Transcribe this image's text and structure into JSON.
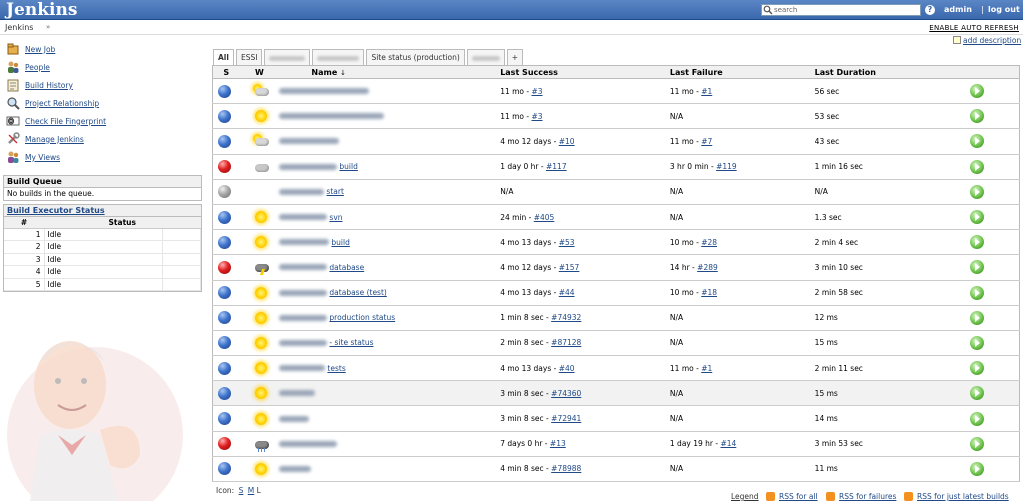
{
  "header": {
    "title": "Jenkins",
    "search_placeholder": "search",
    "help_label": "?",
    "user": "admin",
    "separator": "|",
    "logout": "log out"
  },
  "breadcrumb": {
    "root": "Jenkins",
    "arrow": "»",
    "auto_refresh": "ENABLE AUTO REFRESH"
  },
  "side_tasks": [
    {
      "label": "New Job",
      "icon": "new-job-icon"
    },
    {
      "label": "People",
      "icon": "people-icon"
    },
    {
      "label": "Build History",
      "icon": "build-history-icon"
    },
    {
      "label": "Project Relationship",
      "icon": "magnifier-icon"
    },
    {
      "label": "Check File Fingerprint",
      "icon": "fingerprint-icon"
    },
    {
      "label": "Manage Jenkins",
      "icon": "wrench-icon"
    },
    {
      "label": "My Views",
      "icon": "views-icon"
    }
  ],
  "build_queue": {
    "title": "Build Queue",
    "empty_text": "No builds in the queue."
  },
  "executors": {
    "title": "Build Executor Status",
    "col_num": "#",
    "col_status": "Status",
    "rows": [
      {
        "n": "1",
        "status": "Idle"
      },
      {
        "n": "2",
        "status": "Idle"
      },
      {
        "n": "3",
        "status": "Idle"
      },
      {
        "n": "4",
        "status": "Idle"
      },
      {
        "n": "5",
        "status": "Idle"
      }
    ]
  },
  "add_description": "add description",
  "tabs": [
    {
      "label": "All",
      "active": true
    },
    {
      "label": "ESSI"
    },
    {
      "label": ""
    },
    {
      "label": ""
    },
    {
      "label": "Site status (production)"
    },
    {
      "label": ""
    },
    {
      "label": "+"
    }
  ],
  "table": {
    "headers": {
      "s": "S",
      "w": "W",
      "name": "Name",
      "sort_arrow": "↓",
      "last_success": "Last Success",
      "last_failure": "Last Failure",
      "last_duration": "Last Duration"
    },
    "rows": [
      {
        "status": "blue",
        "weather": "cloud-sun",
        "name": "",
        "last_success": "11 mo - ",
        "success_link": "#3",
        "last_failure": "11 mo - ",
        "failure_link": "#1",
        "duration": "56 sec"
      },
      {
        "status": "blue",
        "weather": "sun",
        "name": "",
        "last_success": "11 mo - ",
        "success_link": "#3",
        "last_failure": "N/A",
        "failure_link": "",
        "duration": "53 sec"
      },
      {
        "status": "blue",
        "weather": "cloud-sun",
        "name": "",
        "last_success": "4 mo 12 days - ",
        "success_link": "#10",
        "last_failure": "11 mo - ",
        "failure_link": "#7",
        "duration": "43 sec"
      },
      {
        "status": "red",
        "weather": "cloud",
        "name": "build",
        "last_success": "1 day 0 hr - ",
        "success_link": "#117",
        "last_failure": "3 hr 0 min - ",
        "failure_link": "#119",
        "duration": "1 min 16 sec"
      },
      {
        "status": "grey",
        "weather": "none",
        "name": "start",
        "last_success": "N/A",
        "success_link": "",
        "last_failure": "N/A",
        "failure_link": "",
        "duration": "N/A"
      },
      {
        "status": "blue",
        "weather": "sun",
        "name": "svn",
        "last_success": "24 min - ",
        "success_link": "#405",
        "last_failure": "N/A",
        "failure_link": "",
        "duration": "1.3 sec"
      },
      {
        "status": "blue",
        "weather": "sun",
        "name": "build",
        "last_success": "4 mo 13 days - ",
        "success_link": "#53",
        "last_failure": "10 mo - ",
        "failure_link": "#28",
        "duration": "2 min 4 sec"
      },
      {
        "status": "red",
        "weather": "storm",
        "name": "database",
        "last_success": "4 mo 12 days - ",
        "success_link": "#157",
        "last_failure": "14 hr - ",
        "failure_link": "#289",
        "duration": "3 min 10 sec"
      },
      {
        "status": "blue",
        "weather": "sun",
        "name": "database (test)",
        "last_success": "4 mo 13 days - ",
        "success_link": "#44",
        "last_failure": "10 mo - ",
        "failure_link": "#18",
        "duration": "2 min 58 sec"
      },
      {
        "status": "blue",
        "weather": "sun",
        "name": "production status",
        "last_success": "1 min 8 sec - ",
        "success_link": "#74932",
        "last_failure": "N/A",
        "failure_link": "",
        "duration": "12 ms"
      },
      {
        "status": "blue",
        "weather": "sun",
        "name": "- site status",
        "last_success": "2 min 8 sec - ",
        "success_link": "#87128",
        "last_failure": "N/A",
        "failure_link": "",
        "duration": "15 ms"
      },
      {
        "status": "blue",
        "weather": "sun",
        "name": "tests",
        "last_success": "4 mo 13 days - ",
        "success_link": "#40",
        "last_failure": "11 mo - ",
        "failure_link": "#1",
        "duration": "2 min 11 sec"
      },
      {
        "status": "blue",
        "weather": "sun",
        "name": "",
        "last_success": "3 min 8 sec - ",
        "success_link": "#74360",
        "last_failure": "N/A",
        "failure_link": "",
        "duration": "15 ms",
        "highlight": true
      },
      {
        "status": "blue",
        "weather": "sun",
        "name": "",
        "last_success": "3 min 8 sec - ",
        "success_link": "#72941",
        "last_failure": "N/A",
        "failure_link": "",
        "duration": "14 ms"
      },
      {
        "status": "red",
        "weather": "rain",
        "name": "",
        "last_success": "7 days 0 hr - ",
        "success_link": "#13",
        "last_failure": "1 day 19 hr - ",
        "failure_link": "#14",
        "duration": "3 min 53 sec"
      },
      {
        "status": "blue",
        "weather": "sun",
        "name": "",
        "last_success": "4 min 8 sec - ",
        "success_link": "#78988",
        "last_failure": "N/A",
        "failure_link": "",
        "duration": "11 ms"
      }
    ]
  },
  "footer": {
    "icon_label": "Icon:",
    "sizes": [
      "S",
      "M",
      "L"
    ],
    "legend": "Legend",
    "rss_all": "RSS for all",
    "rss_failures": "RSS for failures",
    "rss_latest": "RSS for just latest builds"
  },
  "colors": {
    "header_blue": "#3a68ad",
    "link": "#204a87",
    "run_green": "#6cc24a"
  }
}
